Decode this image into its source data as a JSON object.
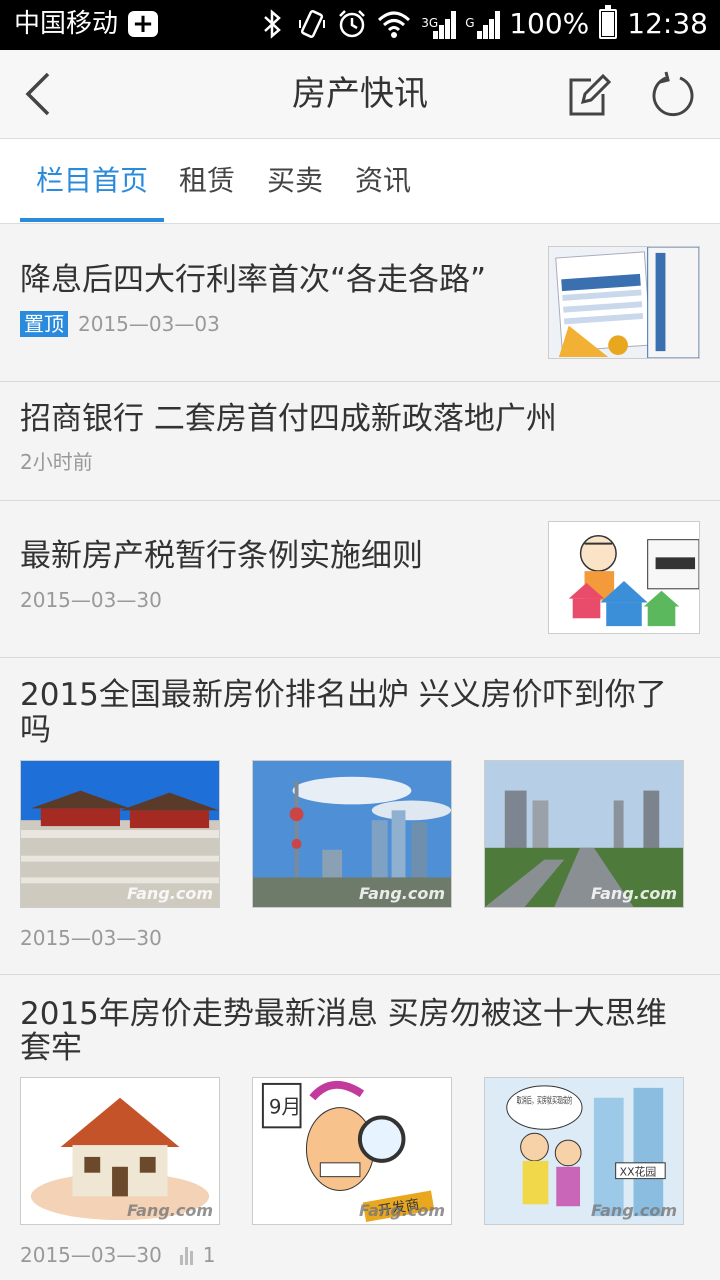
{
  "status_bar": {
    "carrier": "中国移动",
    "network_3g": "3G",
    "network_g": "G",
    "battery": "100%",
    "time": "12:38"
  },
  "app_bar": {
    "title": "房产快讯"
  },
  "tabs": [
    {
      "label": "栏目首页",
      "active": true
    },
    {
      "label": "租赁",
      "active": false
    },
    {
      "label": "买卖",
      "active": false
    },
    {
      "label": "资讯",
      "active": false
    }
  ],
  "news": [
    {
      "title": "降息后四大行利率首次“各走各路”",
      "pinned_label": "置顶",
      "date": "2015—03—03"
    },
    {
      "title": "招商银行 二套房首付四成新政落地广州",
      "date": "2小时前"
    },
    {
      "title": "最新房产税暂行条例实施细则",
      "date": "2015—03—30"
    },
    {
      "title_line1": "2015全国最新房价排名出炉 兴义房价吓到你了",
      "title_line2": "吗",
      "date": "2015—03—30",
      "watermark": "Fang.com"
    },
    {
      "title_line1": "2015年房价走势最新消息 买房勿被这十大思维",
      "title_line2": "套牢",
      "date": "2015—03—30",
      "views": "1",
      "watermark": "Fang.com",
      "cartoon_text": "取消后，买房就买现成的",
      "cartoon_sign": "XX花园",
      "cartoon_sign2": "开发商",
      "calendar": "9月"
    }
  ],
  "colors": {
    "accent": "#2a8bdc",
    "statusbar": "#000000"
  }
}
